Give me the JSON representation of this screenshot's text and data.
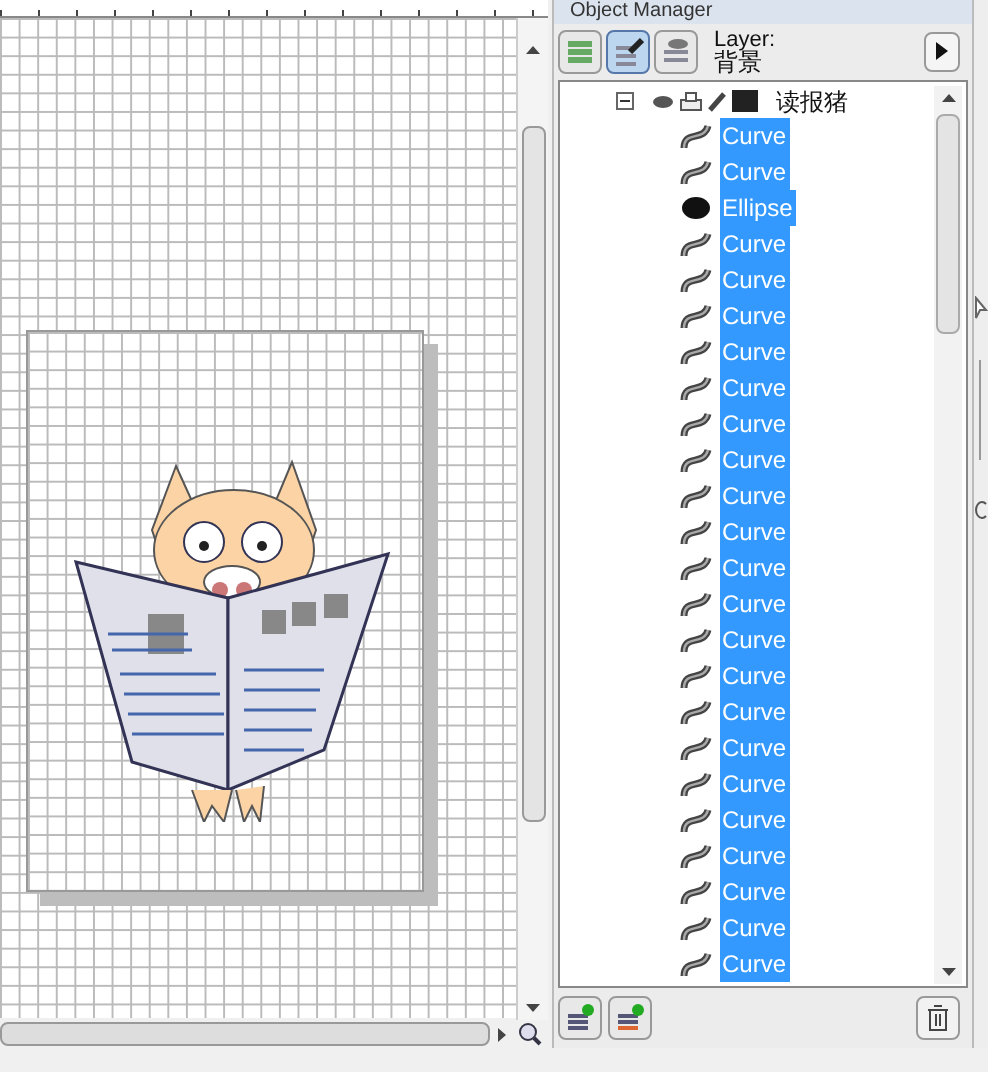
{
  "panel": {
    "title": "Object Manager",
    "layer_label": "Layer:",
    "layer_name": "背景"
  },
  "tree": {
    "label": "读报猪",
    "expanded": true,
    "children": [
      {
        "kind": "curve",
        "label": "Curve",
        "selected": true
      },
      {
        "kind": "curve",
        "label": "Curve",
        "selected": true
      },
      {
        "kind": "ellipse",
        "label": "Ellipse",
        "selected": true
      },
      {
        "kind": "curve",
        "label": "Curve",
        "selected": true
      },
      {
        "kind": "curve",
        "label": "Curve",
        "selected": true
      },
      {
        "kind": "curve",
        "label": "Curve",
        "selected": true
      },
      {
        "kind": "curve",
        "label": "Curve",
        "selected": true
      },
      {
        "kind": "curve",
        "label": "Curve",
        "selected": true
      },
      {
        "kind": "curve",
        "label": "Curve",
        "selected": true
      },
      {
        "kind": "curve",
        "label": "Curve",
        "selected": true
      },
      {
        "kind": "curve",
        "label": "Curve",
        "selected": true
      },
      {
        "kind": "curve",
        "label": "Curve",
        "selected": true
      },
      {
        "kind": "curve",
        "label": "Curve",
        "selected": true
      },
      {
        "kind": "curve",
        "label": "Curve",
        "selected": true
      },
      {
        "kind": "curve",
        "label": "Curve",
        "selected": true
      },
      {
        "kind": "curve",
        "label": "Curve",
        "selected": true
      },
      {
        "kind": "curve",
        "label": "Curve",
        "selected": true
      },
      {
        "kind": "curve",
        "label": "Curve",
        "selected": true
      },
      {
        "kind": "curve",
        "label": "Curve",
        "selected": true
      },
      {
        "kind": "curve",
        "label": "Curve",
        "selected": true
      },
      {
        "kind": "curve",
        "label": "Curve",
        "selected": true
      },
      {
        "kind": "curve",
        "label": "Curve",
        "selected": true
      },
      {
        "kind": "curve",
        "label": "Curve",
        "selected": true
      },
      {
        "kind": "curve",
        "label": "Curve",
        "selected": true
      }
    ]
  }
}
